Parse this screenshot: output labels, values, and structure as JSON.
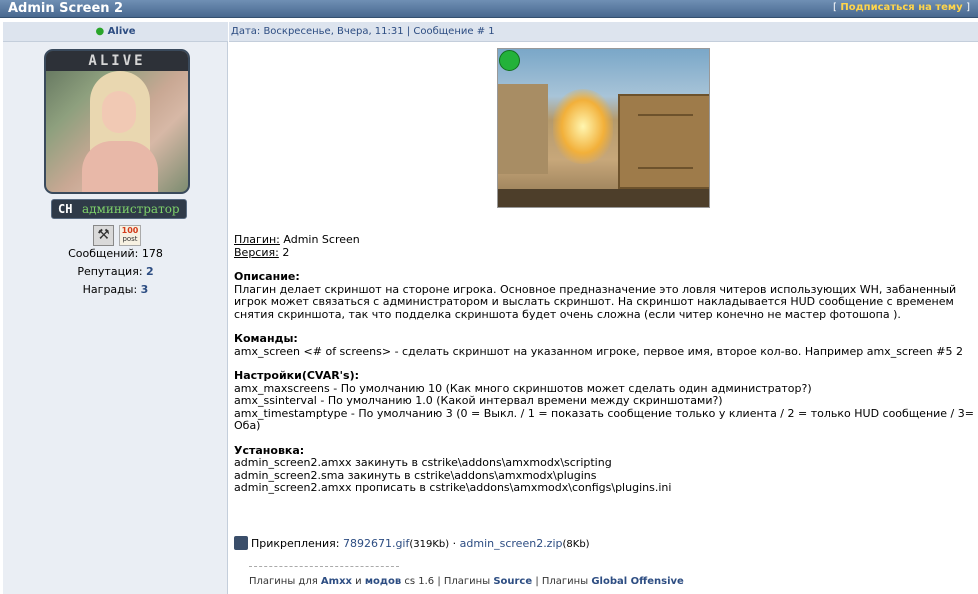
{
  "topbar": {
    "title": "Admin Screen 2",
    "subscribe_open": "[",
    "subscribe_label": "Подписаться на тему",
    "subscribe_close": "]"
  },
  "user": {
    "status": "Alive",
    "avatar_logo": "ALIVE",
    "rank_prefix": "CH",
    "rank": "администратор",
    "badge_post_top": "100",
    "badge_post_bottom": "post",
    "posts_label": "Сообщений:",
    "posts_value": "178",
    "reputation_label": "Репутация:",
    "reputation_value": "2",
    "awards_label": "Награды:",
    "awards_value": "3"
  },
  "post": {
    "meta_date": "Дата: Воскресенье, Вчера, 11:31",
    "meta_sep": "|",
    "meta_num": "Сообщение # 1",
    "plugin_label": "Плагин:",
    "plugin_value": "Admin Screen",
    "version_label": "Версия:",
    "version_value": "2",
    "desc_heading": "Описание:",
    "desc_text": "Плагин делает скриншот на стороне игрока. Основное предназначение это ловля читеров использующих WH, забаненный игрок может связаться с администратором и выслать скриншот. На скриншот накладывается HUD сообщение с временем снятия скриншота, так что подделка скриншота будет очень сложна (если читер конечно не мастер фотошопа ).",
    "cmd_heading": "Команды:",
    "cmd_text": "amx_screen <# of screens> - сделать скриншот на указанном игроке, первое имя, второе кол-во. Например amx_screen #5 2",
    "cvar_heading": "Настройки(CVAR's):",
    "cvar_lines": [
      "amx_maxscreens - По умолчанию 10 (Как много скриншотов может сделать один администратор?)",
      "amx_ssinterval - По умолчанию 1.0 (Какой интервал времени между скриншотами?)",
      "amx_timestamptype - По умолчанию 3 (0 = Выкл. / 1 = показать сообщение только у клиента / 2 = только HUD сообщение / 3= Оба)"
    ],
    "install_heading": "Установка:",
    "install_lines": [
      "admin_screen2.amxx закинуть в cstrike\\addons\\amxmodx\\scripting",
      "admin_screen2.sma закинуть в cstrike\\addons\\amxmodx\\plugins",
      "admin_screen2.amxx прописать в cstrike\\addons\\amxmodx\\configs\\plugins.ini"
    ],
    "attach_label": "Прикрепления:",
    "attach1_name": "7892671.gif",
    "attach1_size": "(319Kb)",
    "attach_sep": "·",
    "attach2_name": "admin_screen2.zip",
    "attach2_size": "(8Kb)"
  },
  "signature": {
    "t1": "Плагины для",
    "amxx": "Amxx",
    "and": "и",
    "mods": "модов",
    "cs": "cs 1.6 | Плагины",
    "source": "Source",
    "sep": "| Плагины",
    "go": "Global Offensive"
  }
}
